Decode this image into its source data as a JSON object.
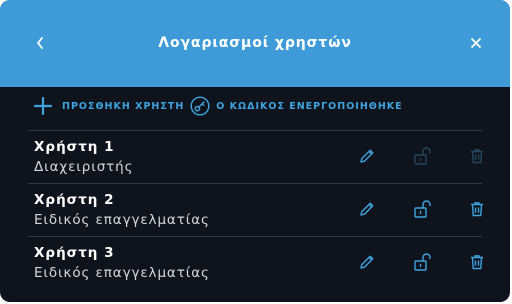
{
  "header": {
    "title": "Λογαριασμοί χρηστών"
  },
  "actions": {
    "add_user_label": "ΠΡΟΣΘΗΚΗ ΧΡΗΣΤΗ",
    "password_status_label": "Ο ΚΩΔΙΚΟΣ ΕΝΕΡΓΟΠΟΙΗΘΗΚΕ"
  },
  "users": [
    {
      "name": "Χρήστη 1",
      "role": "Διαχειριστής",
      "actions_enabled": false
    },
    {
      "name": "Χρήστη 2",
      "role": "Ειδικός επαγγελματίας",
      "actions_enabled": true
    },
    {
      "name": "Χρήστη 3",
      "role": "Ειδικός επαγγελματίας",
      "actions_enabled": true
    }
  ],
  "icons": {
    "back": "chevron-left-icon",
    "close": "close-icon",
    "add": "plus-icon",
    "password": "key-circle-icon",
    "edit": "pencil-icon",
    "lock": "unlock-icon",
    "delete": "trash-icon"
  },
  "colors": {
    "header_bg": "#3f9bd7",
    "body_bg": "#0f141c",
    "accent": "#3fa3e0",
    "disabled_icon": "#24455f",
    "divider": "#333a45"
  }
}
